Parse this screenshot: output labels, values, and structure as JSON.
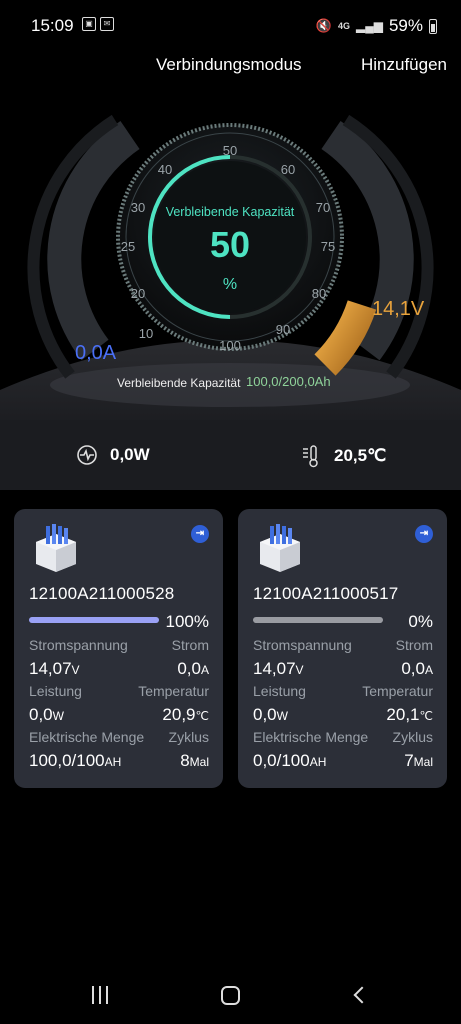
{
  "status_bar": {
    "time": "15:09",
    "network": "4G",
    "battery": "59%"
  },
  "header": {
    "connection_mode": "Verbindungsmodus",
    "add": "Hinzufügen"
  },
  "gauge": {
    "title": "Verbleibende Kapazität",
    "value": "50",
    "unit": "%",
    "level_percent": 50,
    "ticks": [
      "10",
      "20",
      "25",
      "30",
      "40",
      "50",
      "60",
      "70",
      "75",
      "80",
      "90",
      "100"
    ],
    "current": "0,0A",
    "voltage": "14,1V",
    "remaining_label": "Verbleibende Kapazität",
    "remaining_value": "100,0/200,0Ah"
  },
  "stats": {
    "power": "0,0W",
    "temperature": "20,5℃"
  },
  "cards": [
    {
      "id": "12100A211000528",
      "percent": "100%",
      "level": 100,
      "voltage_label": "Stromspannung",
      "current_label": "Strom",
      "voltage": "14,07",
      "voltage_unit": "V",
      "current": "0,0",
      "current_unit": "A",
      "power_label": "Leistung",
      "temp_label": "Temperatur",
      "power": "0,0",
      "power_unit": "W",
      "temp": "20,9",
      "temp_unit": "℃",
      "energy_label": "Elektrische Menge",
      "cycle_label": "Zyklus",
      "energy": "100,0/100",
      "energy_unit": "AH",
      "cycle": "8",
      "cycle_unit": "Mal"
    },
    {
      "id": "12100A211000517",
      "percent": "0%",
      "level": 0,
      "voltage_label": "Stromspannung",
      "current_label": "Strom",
      "voltage": "14,07",
      "voltage_unit": "V",
      "current": "0,0",
      "current_unit": "A",
      "power_label": "Leistung",
      "temp_label": "Temperatur",
      "power": "0,0",
      "power_unit": "W",
      "temp": "20,1",
      "temp_unit": "℃",
      "energy_label": "Elektrische Menge",
      "cycle_label": "Zyklus",
      "energy": "0,0/100",
      "energy_unit": "AH",
      "cycle": "7",
      "cycle_unit": "Mal"
    }
  ],
  "colors": {
    "accent": "#4ee3c2",
    "current": "#4a6ff5",
    "voltage": "#e8a33c",
    "card_bg": "#2c2f38"
  }
}
